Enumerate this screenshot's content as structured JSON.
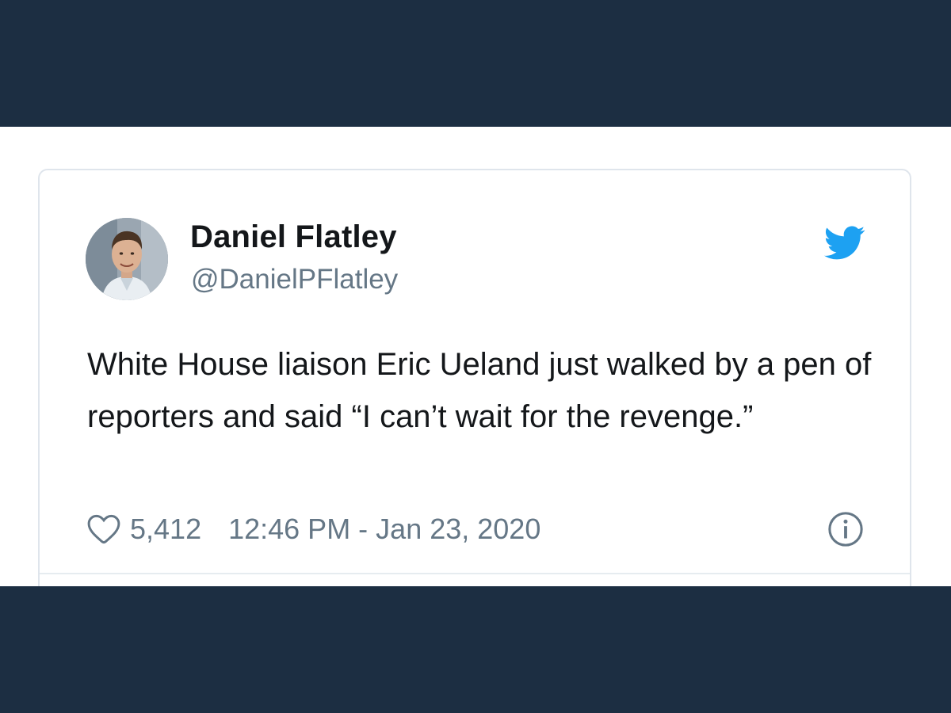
{
  "author": {
    "display_name": "Daniel Flatley",
    "handle": "@DanielPFlatley",
    "avatar_icon": "profile-photo"
  },
  "tweet": {
    "text": "White House liaison Eric Ueland just walked by a pen of reporters and said “I can’t wait for the revenge.”",
    "like_count": "5,412",
    "timestamp": "12:46 PM - Jan 23, 2020"
  },
  "icons": {
    "brand": "twitter-bird-icon",
    "like": "heart-icon",
    "info": "info-icon"
  },
  "colors": {
    "background_band": "#1c2e42",
    "twitter_blue": "#1da1f2",
    "text_primary": "#14171a",
    "text_secondary": "#657786",
    "card_border": "#dfe5ec"
  }
}
